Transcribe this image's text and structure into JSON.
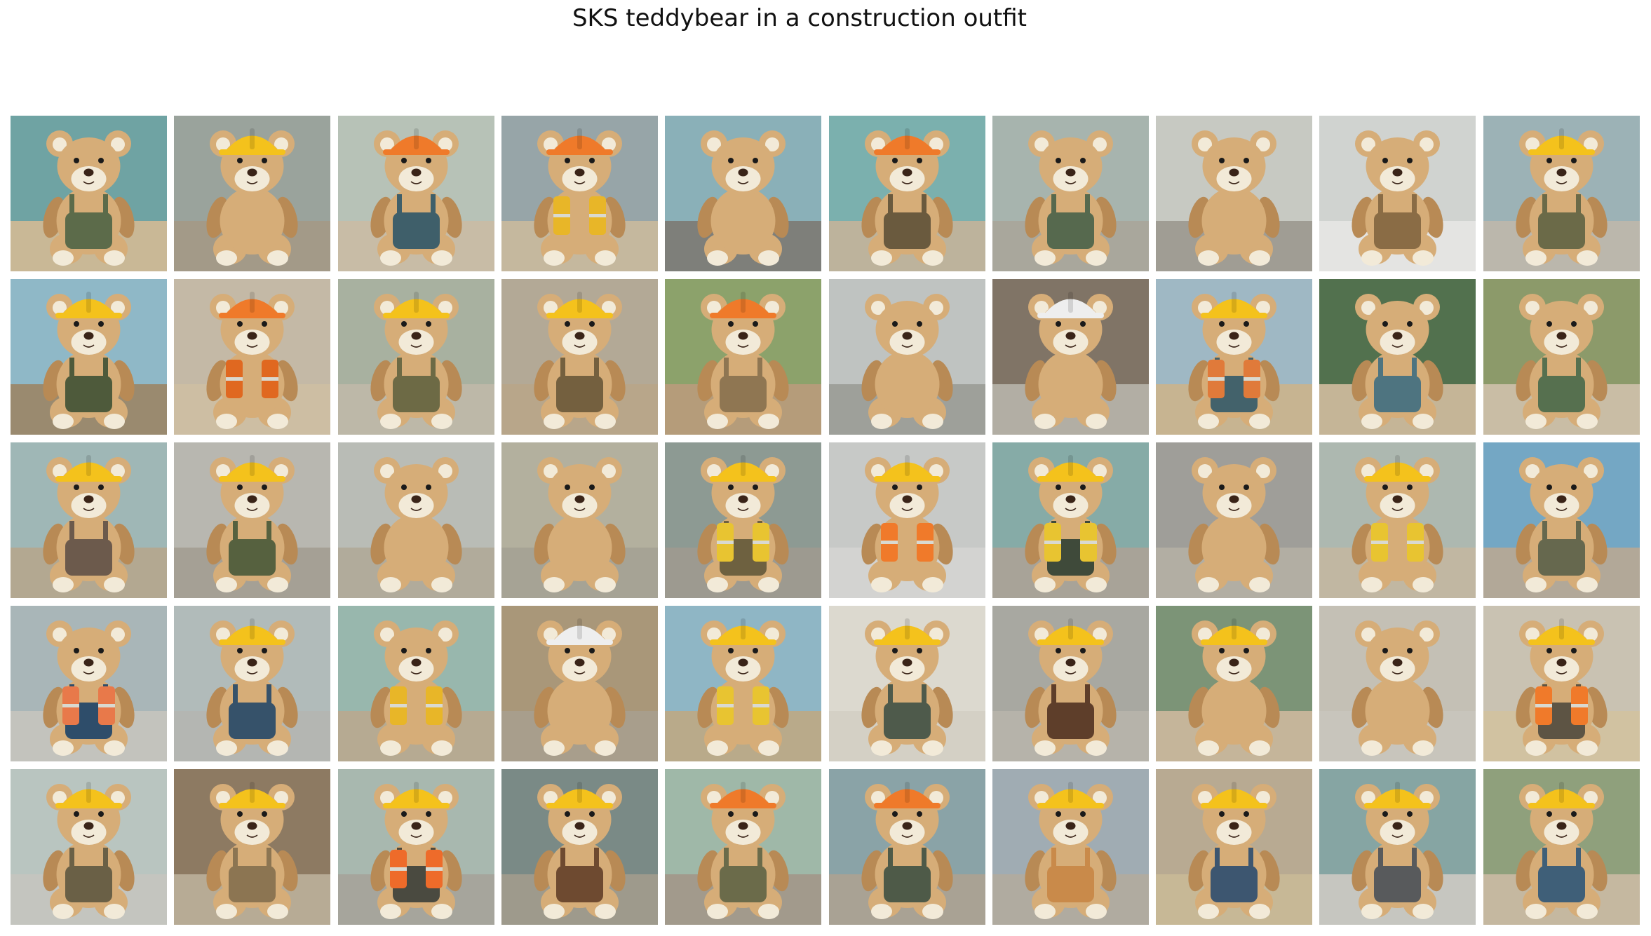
{
  "title": "SKS teddybear in a construction outfit",
  "grid": {
    "rows": 5,
    "cols": 10
  },
  "palette": {
    "fur": "#d6ad78",
    "fur_dark": "#b88a55",
    "muzzle": "#f2ead8",
    "nose": "#3a2418",
    "helmet_yellow": "#f4c21c",
    "helmet_orange": "#ef7a2a",
    "helmet_white": "#eeeeee"
  },
  "tiles": [
    {
      "bg": "#6fa3a3",
      "ground": "#c9b896",
      "helmet": "none",
      "outfit": "#5c6b4a",
      "vest": "none"
    },
    {
      "bg": "#9aa39c",
      "ground": "#a39a88",
      "helmet": "yellow",
      "outfit": "none",
      "vest": "none"
    },
    {
      "bg": "#b7c2b7",
      "ground": "#c8bca6",
      "helmet": "orange",
      "outfit": "#3f5f6a",
      "vest": "none"
    },
    {
      "bg": "#97a5a8",
      "ground": "#c5b89e",
      "helmet": "orange",
      "outfit": "none",
      "vest": "#e8b628"
    },
    {
      "bg": "#8ab0b8",
      "ground": "#7e7f7a",
      "helmet": "none",
      "outfit": "none",
      "vest": "none"
    },
    {
      "bg": "#7bb0ae",
      "ground": "#bdb39c",
      "helmet": "orange",
      "outfit": "#6a5a3e",
      "vest": "none"
    },
    {
      "bg": "#a7b4ae",
      "ground": "#a9a79c",
      "helmet": "none",
      "outfit": "#56694e",
      "vest": "none"
    },
    {
      "bg": "#c7c9c2",
      "ground": "#a09d94",
      "helmet": "none",
      "outfit": "none",
      "vest": "none"
    },
    {
      "bg": "#d0d3d0",
      "ground": "#e4e4e2",
      "helmet": "none",
      "outfit": "#8a6c45",
      "vest": "none"
    },
    {
      "bg": "#9cb2b6",
      "ground": "#bbb7ac",
      "helmet": "yellow",
      "outfit": "#6b6a48",
      "vest": "none"
    },
    {
      "bg": "#8fb8c7",
      "ground": "#9a8a6f",
      "helmet": "yellow",
      "outfit": "#4e5a3b",
      "vest": "none"
    },
    {
      "bg": "#c4b9a6",
      "ground": "#cdbea3",
      "helmet": "orange",
      "outfit": "none",
      "vest": "#e06820"
    },
    {
      "bg": "#a8b1a0",
      "ground": "#bdb8a8",
      "helmet": "yellow",
      "outfit": "#6d6a45",
      "vest": "none"
    },
    {
      "bg": "#b3a996",
      "ground": "#b8a68a",
      "helmet": "yellow",
      "outfit": "#74603f",
      "vest": "none"
    },
    {
      "bg": "#8ca26b",
      "ground": "#b59c7a",
      "helmet": "orange",
      "outfit": "#8f7652",
      "vest": "none"
    },
    {
      "bg": "#bfc3c1",
      "ground": "#9ea09a",
      "helmet": "none",
      "outfit": "none",
      "vest": "none"
    },
    {
      "bg": "#807466",
      "ground": "#b2aea4",
      "helmet": "white",
      "outfit": "none",
      "vest": "none"
    },
    {
      "bg": "#9fb8c4",
      "ground": "#c7b491",
      "helmet": "yellow",
      "outfit": "#43626b",
      "vest": "#e07a3a"
    },
    {
      "bg": "#52714e",
      "ground": "#c5b597",
      "helmet": "none",
      "outfit": "#4e7480",
      "vest": "none"
    },
    {
      "bg": "#8c9a6a",
      "ground": "#c9bda5",
      "helmet": "none",
      "outfit": "#56704f",
      "vest": "none"
    },
    {
      "bg": "#9fb7b6",
      "ground": "#b3a891",
      "helmet": "yellow",
      "outfit": "#6c5a4c",
      "vest": "none"
    },
    {
      "bg": "#b8b7b0",
      "ground": "#a5a095",
      "helmet": "yellow",
      "outfit": "#56613f",
      "vest": "none"
    },
    {
      "bg": "#b9bcb6",
      "ground": "#b1ab9b",
      "helmet": "none",
      "outfit": "none",
      "vest": "none"
    },
    {
      "bg": "#b3b09e",
      "ground": "#a6a395",
      "helmet": "none",
      "outfit": "none",
      "vest": "none"
    },
    {
      "bg": "#8d9a93",
      "ground": "#9d9a90",
      "helmet": "yellow",
      "outfit": "#6e6140",
      "vest": "#e8c431"
    },
    {
      "bg": "#c7c9c7",
      "ground": "#d3d3d1",
      "helmet": "yellow",
      "outfit": "none",
      "vest": "#f07a2a"
    },
    {
      "bg": "#86aba7",
      "ground": "#a8a398",
      "helmet": "yellow",
      "outfit": "#3f4a3a",
      "vest": "#e8c431"
    },
    {
      "bg": "#9f9e99",
      "ground": "#b2aea3",
      "helmet": "none",
      "outfit": "none",
      "vest": "none"
    },
    {
      "bg": "#adb8b0",
      "ground": "#c1b7a2",
      "helmet": "yellow",
      "outfit": "none",
      "vest": "#e8c431"
    },
    {
      "bg": "#74a7c4",
      "ground": "#b2a898",
      "helmet": "none",
      "outfit": "#66684e",
      "vest": "none"
    },
    {
      "bg": "#a9b6b8",
      "ground": "#c3c3bd",
      "helmet": "none",
      "outfit": "#2e4d6a",
      "vest": "#e8794a"
    },
    {
      "bg": "#b1bbba",
      "ground": "#b4b6b2",
      "helmet": "yellow",
      "outfit": "#36526a",
      "vest": "none"
    },
    {
      "bg": "#98b7ad",
      "ground": "#b6aa92",
      "helmet": "none",
      "outfit": "none",
      "vest": "#e8b628"
    },
    {
      "bg": "#a99779",
      "ground": "#a89e8c",
      "helmet": "white",
      "outfit": "none",
      "vest": "none"
    },
    {
      "bg": "#8fb6c5",
      "ground": "#b9aa8a",
      "helmet": "yellow",
      "outfit": "none",
      "vest": "#e8c431"
    },
    {
      "bg": "#dcd9cf",
      "ground": "#d4d0c5",
      "helmet": "yellow",
      "outfit": "#4e5a4b",
      "vest": "none"
    },
    {
      "bg": "#a8a8a1",
      "ground": "#b6b3aa",
      "helmet": "yellow",
      "outfit": "#5e3e2a",
      "vest": "none"
    },
    {
      "bg": "#7c9477",
      "ground": "#c5b59a",
      "helmet": "yellow",
      "outfit": "none",
      "vest": "none"
    },
    {
      "bg": "#c4c0b5",
      "ground": "#c8c5bc",
      "helmet": "none",
      "outfit": "none",
      "vest": "none"
    },
    {
      "bg": "#c9c2b2",
      "ground": "#d1c2a1",
      "helmet": "yellow",
      "outfit": "#5d5444",
      "vest": "#f07a2a"
    },
    {
      "bg": "#b9c5c0",
      "ground": "#c4c5bf",
      "helmet": "yellow",
      "outfit": "#6a6046",
      "vest": "none"
    },
    {
      "bg": "#8d7a62",
      "ground": "#b7ab95",
      "helmet": "yellow",
      "outfit": "#8c7552",
      "vest": "none"
    },
    {
      "bg": "#a8b8af",
      "ground": "#a6a59c",
      "helmet": "yellow",
      "outfit": "#4a4a40",
      "vest": "#ee6b2a"
    },
    {
      "bg": "#7a8a86",
      "ground": "#9e9a8c",
      "helmet": "yellow",
      "outfit": "#6e4a30",
      "vest": "none"
    },
    {
      "bg": "#9fb8a8",
      "ground": "#a29a8c",
      "helmet": "orange",
      "outfit": "#6b6b4a",
      "vest": "none"
    },
    {
      "bg": "#8aa3a7",
      "ground": "#a9a294",
      "helmet": "orange",
      "outfit": "#4e5a48",
      "vest": "none"
    },
    {
      "bg": "#a0acb3",
      "ground": "#b0aba0",
      "helmet": "yellow",
      "outfit": "#c98a4a",
      "vest": "none"
    },
    {
      "bg": "#b8aa92",
      "ground": "#c7b896",
      "helmet": "yellow",
      "outfit": "#3d5670",
      "vest": "none"
    },
    {
      "bg": "#86a5a3",
      "ground": "#c6c6c0",
      "helmet": "yellow",
      "outfit": "#585a5c",
      "vest": "none"
    },
    {
      "bg": "#8fa07c",
      "ground": "#c5b8a0",
      "helmet": "yellow",
      "outfit": "#3f5f78",
      "vest": "none"
    }
  ]
}
